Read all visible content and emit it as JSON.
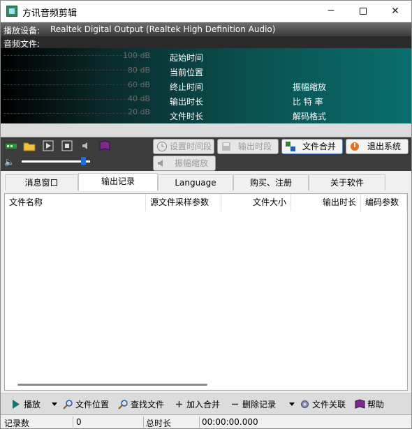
{
  "window": {
    "title": "方讯音频剪辑",
    "minimize": "─",
    "close": "✕"
  },
  "device": {
    "label": "播放设备:",
    "name": "Realtek Digital Output (Realtek High Definition Audio)"
  },
  "file": {
    "label": "音频文件:"
  },
  "meter": {
    "db_levels": [
      "100 dB",
      "80 dB",
      "60 dB",
      "40 dB",
      "20 dB"
    ],
    "info_left": [
      "起始时间",
      "当前位置",
      "终止时间",
      "输出时长",
      "文件时长"
    ],
    "info_right": [
      "振幅缩放",
      "比 特 率",
      "解码格式"
    ]
  },
  "toolbar": {
    "set_segment": "设置时间段",
    "output_segment": "输出时段",
    "file_merge": "文件合并",
    "exit": "退出系统",
    "amplitude": "振幅缩放",
    "volume_level": 0.9
  },
  "tabs": [
    "消息窗口",
    "输出记录",
    "Language",
    "购买、注册",
    "关于软件"
  ],
  "active_tab": 1,
  "table": {
    "columns": [
      "文件名称",
      "源文件采样参数",
      "文件大小",
      "输出时长",
      "编码参数"
    ]
  },
  "bottom": {
    "play": "播放",
    "file_location": "文件位置",
    "find_file": "查找文件",
    "add_merge": "加入合并",
    "delete_record": "删除记录",
    "file_assoc": "文件关联",
    "help": "帮助"
  },
  "status": {
    "records_label": "记录数",
    "records_value": "0",
    "duration_label": "总时长",
    "duration_value": "00:00:00.000"
  },
  "colors": {
    "meter_teal": "#0a6e6e",
    "toolbar_dark": "#3c3c3c",
    "accent_blue": "#1e6fd0"
  }
}
